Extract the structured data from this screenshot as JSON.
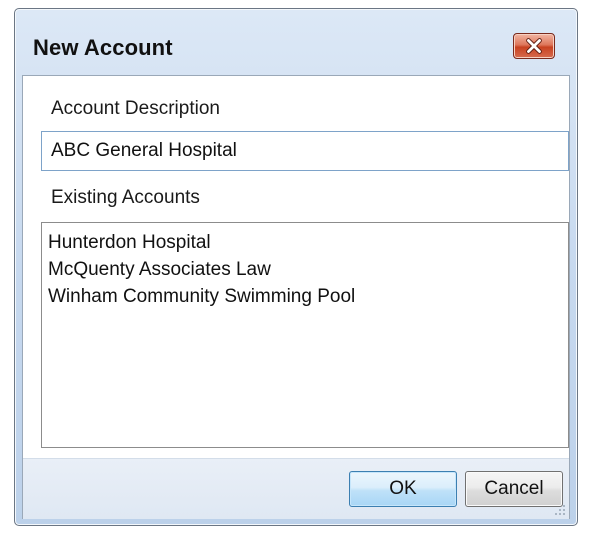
{
  "window": {
    "title": "New Account",
    "close_icon": "close-x-icon",
    "close_color": "#c84221"
  },
  "form": {
    "description_label": "Account Description",
    "description_value": "ABC General Hospital",
    "existing_label": "Existing Accounts",
    "existing_accounts": [
      "Hunterdon Hospital",
      "McQuenty Associates Law",
      "Winham Community Swimming Pool"
    ]
  },
  "buttons": {
    "ok_label": "OK",
    "cancel_label": "Cancel"
  },
  "colors": {
    "title_bar": "#c7d9ef",
    "ok_accent": "#3c7fb1"
  },
  "icons": {
    "resize": "resize-grip-icon"
  }
}
